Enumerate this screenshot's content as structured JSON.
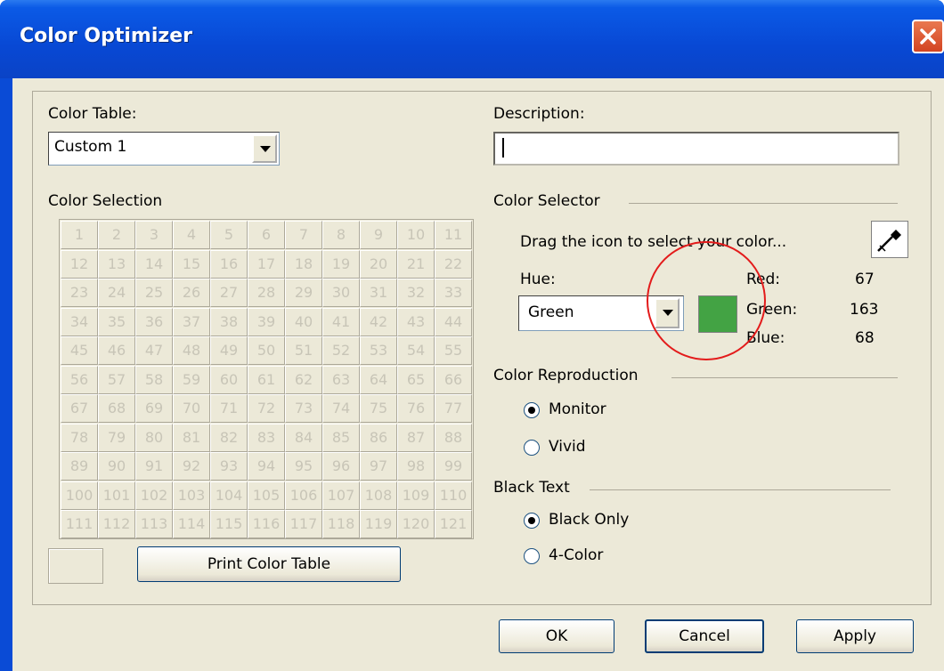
{
  "window": {
    "title": "Color Optimizer"
  },
  "color_table": {
    "label": "Color Table:",
    "selected": "Custom 1"
  },
  "color_selection": {
    "label": "Color Selection",
    "cells": [
      "1",
      "2",
      "3",
      "4",
      "5",
      "6",
      "7",
      "8",
      "9",
      "10",
      "11",
      "12",
      "13",
      "14",
      "15",
      "16",
      "17",
      "18",
      "19",
      "20",
      "21",
      "22",
      "23",
      "24",
      "25",
      "26",
      "27",
      "28",
      "29",
      "30",
      "31",
      "32",
      "33",
      "34",
      "35",
      "36",
      "37",
      "38",
      "39",
      "40",
      "41",
      "42",
      "43",
      "44",
      "45",
      "46",
      "47",
      "48",
      "49",
      "50",
      "51",
      "52",
      "53",
      "54",
      "55",
      "56",
      "57",
      "58",
      "59",
      "60",
      "61",
      "62",
      "63",
      "64",
      "65",
      "66",
      "67",
      "68",
      "69",
      "70",
      "71",
      "72",
      "73",
      "74",
      "75",
      "76",
      "77",
      "78",
      "79",
      "80",
      "81",
      "82",
      "83",
      "84",
      "85",
      "86",
      "87",
      "88",
      "89",
      "90",
      "91",
      "92",
      "93",
      "94",
      "95",
      "96",
      "97",
      "98",
      "99",
      "100",
      "101",
      "102",
      "103",
      "104",
      "105",
      "106",
      "107",
      "108",
      "109",
      "110",
      "111",
      "112",
      "113",
      "114",
      "115",
      "116",
      "117",
      "118",
      "119",
      "120",
      "121"
    ]
  },
  "print_button": {
    "label": "Print Color Table"
  },
  "description": {
    "label": "Description:",
    "value": ""
  },
  "color_selector": {
    "label": "Color Selector",
    "instruction": "Drag the icon to select your color...",
    "hue_label": "Hue:",
    "hue_selected": "Green",
    "swatch_color": "#43a344",
    "red_label": "Red:",
    "red_value": "67",
    "green_label": "Green:",
    "green_value": "163",
    "blue_label": "Blue:",
    "blue_value": "68"
  },
  "color_reproduction": {
    "label": "Color Reproduction",
    "options": [
      {
        "label": "Monitor",
        "selected": true
      },
      {
        "label": "Vivid",
        "selected": false
      }
    ]
  },
  "black_text": {
    "label": "Black Text",
    "options": [
      {
        "label": "Black Only",
        "selected": true
      },
      {
        "label": "4-Color",
        "selected": false
      }
    ]
  },
  "footer": {
    "ok_label": "OK",
    "cancel_label": "Cancel",
    "apply_label": "Apply"
  },
  "annotation": {
    "color": "#e31b1b"
  }
}
